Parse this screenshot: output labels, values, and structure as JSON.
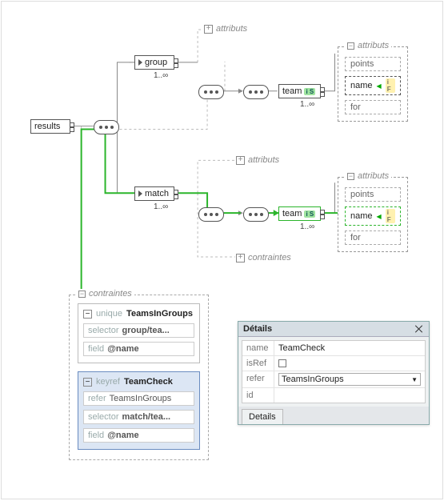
{
  "root": {
    "label": "results"
  },
  "attributs_label": "attributs",
  "contraintes_label": "contraintes",
  "cardinality": "1..∞",
  "group": {
    "label": "group",
    "team": {
      "label": "team",
      "badge": "i S"
    }
  },
  "match": {
    "label": "match",
    "team": {
      "label": "team",
      "badge": "i S"
    }
  },
  "attrs_set1": {
    "points": "points",
    "name": "name",
    "for": "for",
    "name_badge": "i F"
  },
  "attrs_set2": {
    "points": "points",
    "name": "name",
    "for": "for",
    "name_badge": "i F"
  },
  "constraints": {
    "title": "contraintes",
    "unique": {
      "tag": "unique",
      "name": "TeamsInGroups",
      "selector_k": "selector",
      "selector_v": "group/tea...",
      "field_k": "field",
      "field_v": "@name"
    },
    "keyref": {
      "tag": "keyref",
      "name": "TeamCheck",
      "refer_k": "refer",
      "refer_v": "TeamsInGroups",
      "selector_k": "selector",
      "selector_v": "match/tea...",
      "field_k": "field",
      "field_v": "@name"
    }
  },
  "panel": {
    "title": "Détails",
    "rows": {
      "name_k": "name",
      "name_v": "TeamCheck",
      "isref_k": "isRef",
      "refer_k": "refer",
      "refer_v": "TeamsInGroups",
      "id_k": "id"
    },
    "tab": "Details"
  }
}
